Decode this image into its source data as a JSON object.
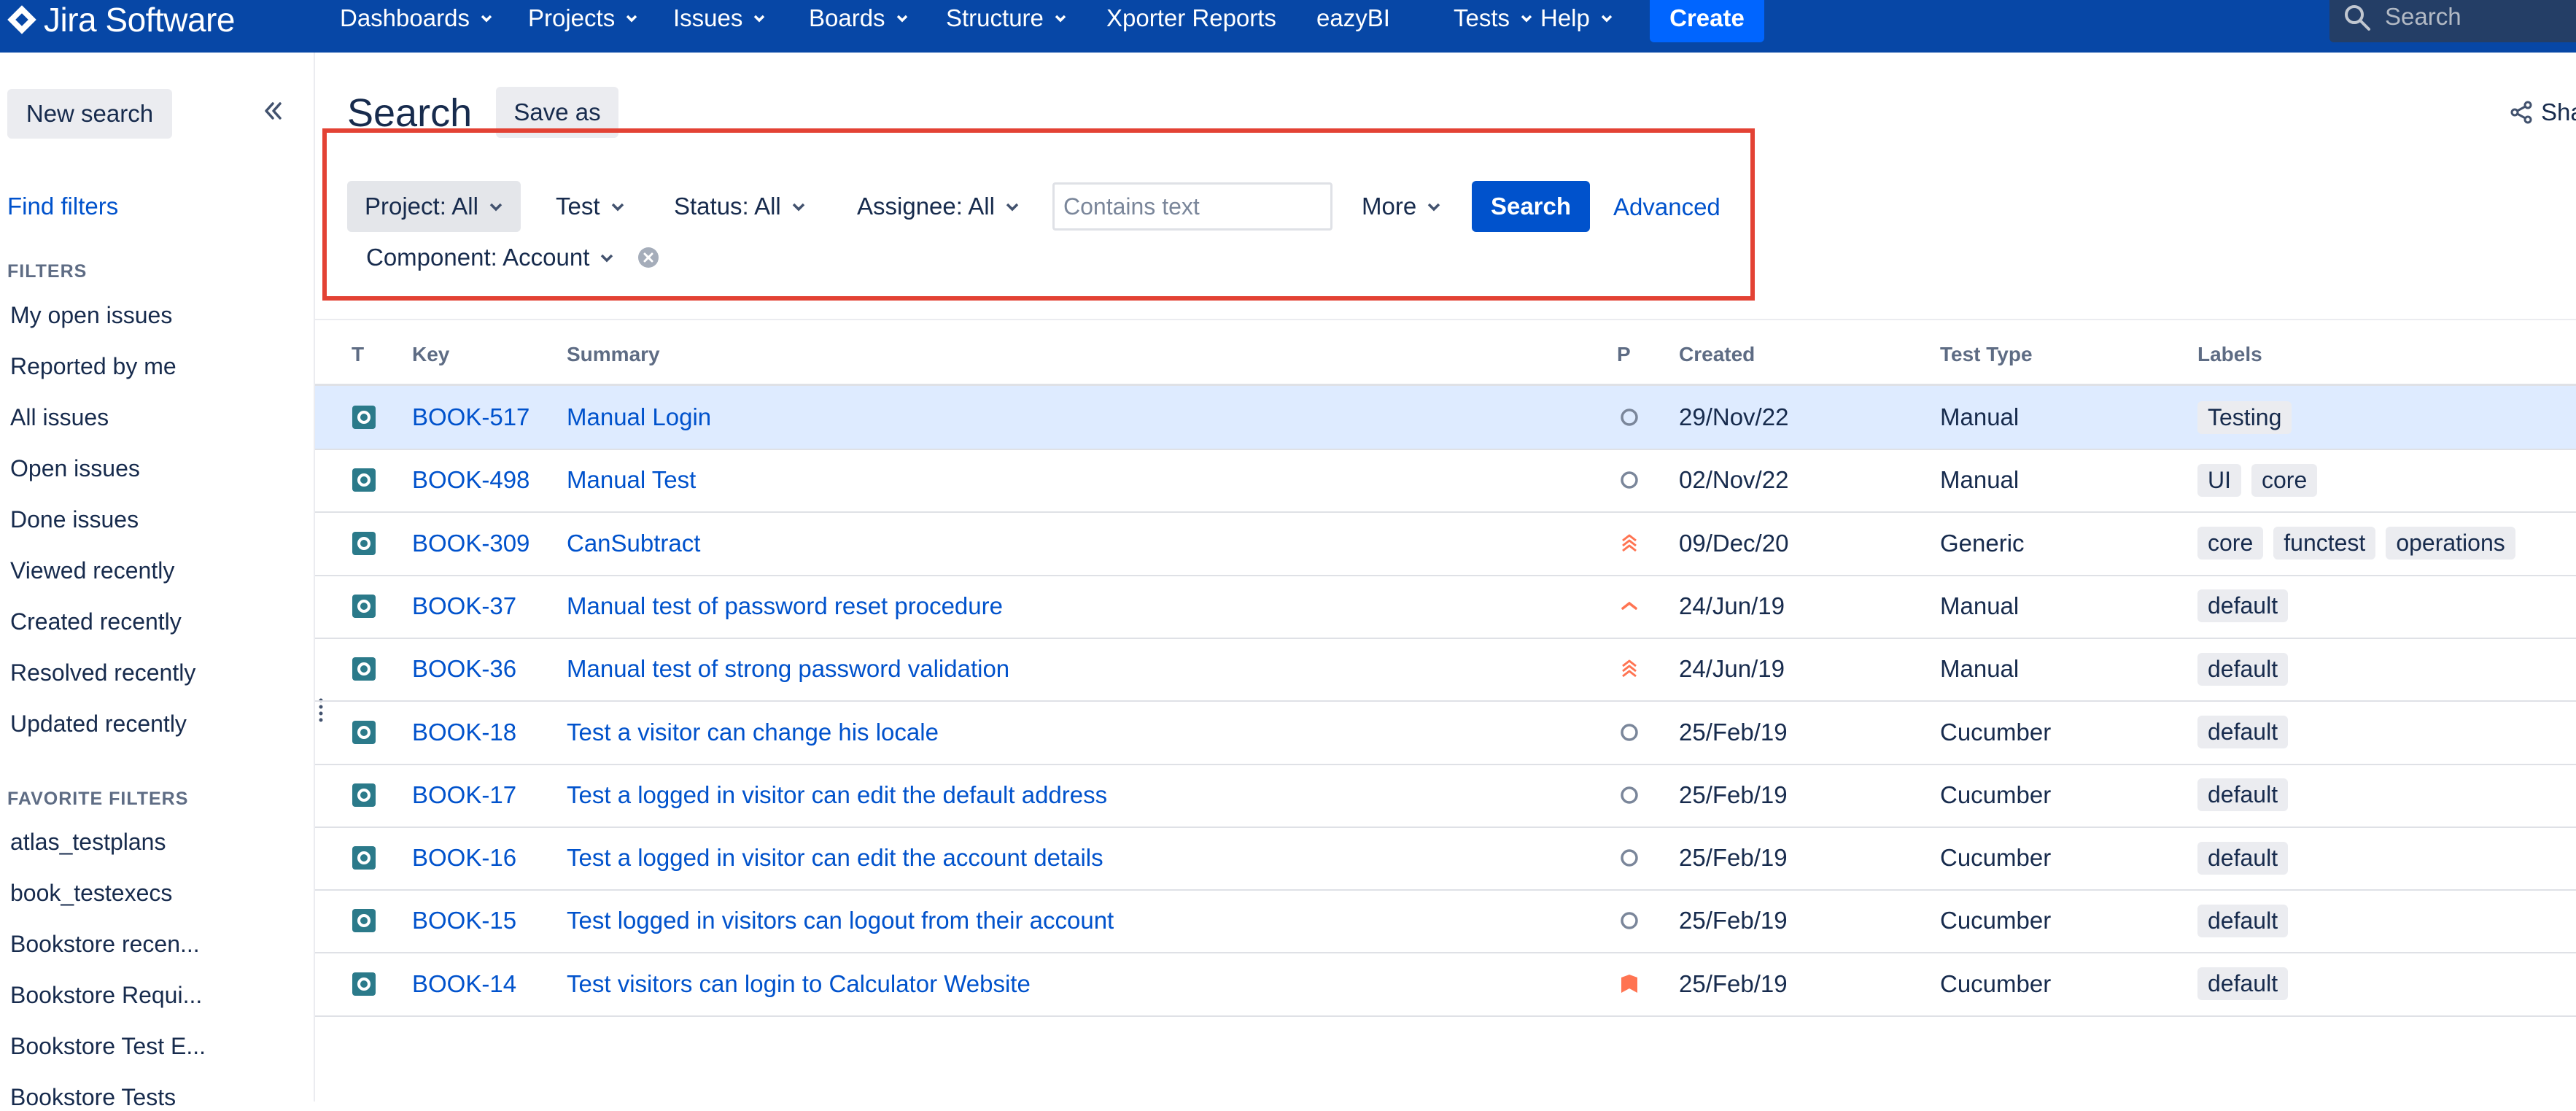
{
  "topnav": {
    "logo_text": "Jira Software",
    "items": [
      {
        "label": "Dashboards",
        "has_menu": true
      },
      {
        "label": "Projects",
        "has_menu": true
      },
      {
        "label": "Issues",
        "has_menu": true
      },
      {
        "label": "Boards",
        "has_menu": true
      },
      {
        "label": "Structure",
        "has_menu": true
      },
      {
        "label": "Xporter Reports",
        "has_menu": false
      },
      {
        "label": "eazyBI",
        "has_menu": false
      },
      {
        "label": "Tests",
        "has_menu": true
      },
      {
        "label": "Help",
        "has_menu": true
      }
    ],
    "create_label": "Create",
    "search_placeholder": "Search"
  },
  "sidebar": {
    "new_search_label": "New search",
    "find_filters_label": "Find filters",
    "filters_heading": "FILTERS",
    "filters": [
      "My open issues",
      "Reported by me",
      "All issues",
      "Open issues",
      "Done issues",
      "Viewed recently",
      "Created recently",
      "Resolved recently",
      "Updated recently"
    ],
    "favorite_heading": "FAVORITE FILTERS",
    "favorites": [
      "atlas_testplans",
      "book_testexecs",
      "Bookstore recen...",
      "Bookstore Requi...",
      "Bookstore Test E...",
      "Bookstore Tests"
    ]
  },
  "main": {
    "title": "Search",
    "save_as_label": "Save as",
    "share_label": "Sha",
    "filters": {
      "project": "Project: All",
      "type": "Test",
      "status": "Status: All",
      "assignee": "Assignee: All",
      "contains_placeholder": "Contains text",
      "more": "More",
      "search_button": "Search",
      "advanced": "Advanced",
      "component": "Component: Account"
    },
    "columns": {
      "t": "T",
      "key": "Key",
      "summary": "Summary",
      "p": "P",
      "created": "Created",
      "test_type": "Test Type",
      "labels": "Labels"
    },
    "rows": [
      {
        "key": "BOOK-517",
        "summary": "Manual Login",
        "priority": "minor",
        "created": "29/Nov/22",
        "test_type": "Manual",
        "labels": [
          "Testing"
        ],
        "selected": true
      },
      {
        "key": "BOOK-498",
        "summary": "Manual Test",
        "priority": "minor",
        "created": "02/Nov/22",
        "test_type": "Manual",
        "labels": [
          "UI",
          "core"
        ]
      },
      {
        "key": "BOOK-309",
        "summary": "CanSubtract",
        "priority": "highest",
        "created": "09/Dec/20",
        "test_type": "Generic",
        "labels": [
          "core",
          "functest",
          "operations"
        ]
      },
      {
        "key": "BOOK-37",
        "summary": "Manual test of password reset procedure",
        "priority": "high",
        "created": "24/Jun/19",
        "test_type": "Manual",
        "labels": [
          "default"
        ]
      },
      {
        "key": "BOOK-36",
        "summary": "Manual test of strong password validation",
        "priority": "highest",
        "created": "24/Jun/19",
        "test_type": "Manual",
        "labels": [
          "default"
        ]
      },
      {
        "key": "BOOK-18",
        "summary": "Test a visitor can change his locale",
        "priority": "minor",
        "created": "25/Feb/19",
        "test_type": "Cucumber",
        "labels": [
          "default"
        ]
      },
      {
        "key": "BOOK-17",
        "summary": "Test a logged in visitor can edit the default address",
        "priority": "minor",
        "created": "25/Feb/19",
        "test_type": "Cucumber",
        "labels": [
          "default"
        ]
      },
      {
        "key": "BOOK-16",
        "summary": "Test a logged in visitor can edit the account details",
        "priority": "minor",
        "created": "25/Feb/19",
        "test_type": "Cucumber",
        "labels": [
          "default"
        ]
      },
      {
        "key": "BOOK-15",
        "summary": "Test logged in visitors can logout from their account",
        "priority": "minor",
        "created": "25/Feb/19",
        "test_type": "Cucumber",
        "labels": [
          "default"
        ]
      },
      {
        "key": "BOOK-14",
        "summary": "Test visitors can login to Calculator Website",
        "priority": "blocker",
        "created": "25/Feb/19",
        "test_type": "Cucumber",
        "labels": [
          "default"
        ]
      }
    ]
  },
  "colors": {
    "nav": "#0747a6",
    "accent": "#0052cc",
    "highlight_box": "#e34234",
    "priority_high": "#ff7452",
    "priority_minor": "#7a869a",
    "test_icon": "#2b7a8a"
  }
}
